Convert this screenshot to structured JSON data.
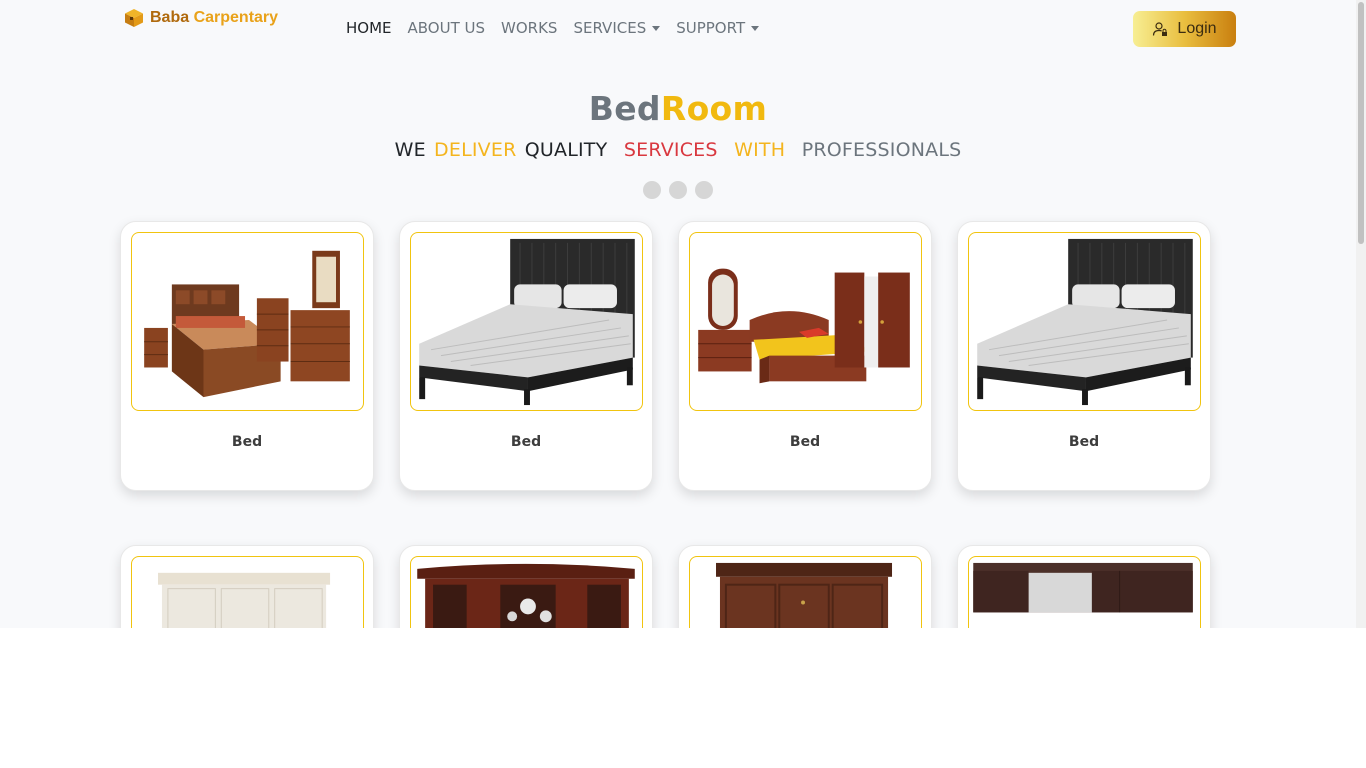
{
  "brand": {
    "name_part1": "Baba",
    "name_part2": "Carpentary"
  },
  "nav": {
    "home": "HOME",
    "about": "ABOUT US",
    "works": "WORKS",
    "services": "SERVICES",
    "support": "SUPPORT"
  },
  "login": {
    "label": "Login",
    "icon": "user-lock-icon"
  },
  "hero": {
    "title_part1": "Bed",
    "title_part2": "Room",
    "subtitle": {
      "w1": "WE",
      "w2": "DELIVER",
      "w3": "QUALITY",
      "w4": "SERVICES",
      "w5": "WITH",
      "w6": "PROFESSIONALS"
    },
    "carousel_dots": 3
  },
  "products_row1": [
    {
      "title": "Bed",
      "image": "wooden-bedroom-set"
    },
    {
      "title": "Bed",
      "image": "black-bed"
    },
    {
      "title": "Bed",
      "image": "bedroom-set-yellow-mattress"
    },
    {
      "title": "Bed",
      "image": "black-bed"
    }
  ],
  "products_row2": [
    {
      "image": "white-wardrobe"
    },
    {
      "image": "glass-cabinet"
    },
    {
      "image": "brown-wardrobe"
    },
    {
      "image": "dark-sliding-wardrobe"
    }
  ],
  "colors": {
    "accent_yellow": "#f1b90f",
    "accent_red": "#d9383f",
    "brand_brown": "#b06a0e",
    "card_border": "#f1c40f"
  }
}
